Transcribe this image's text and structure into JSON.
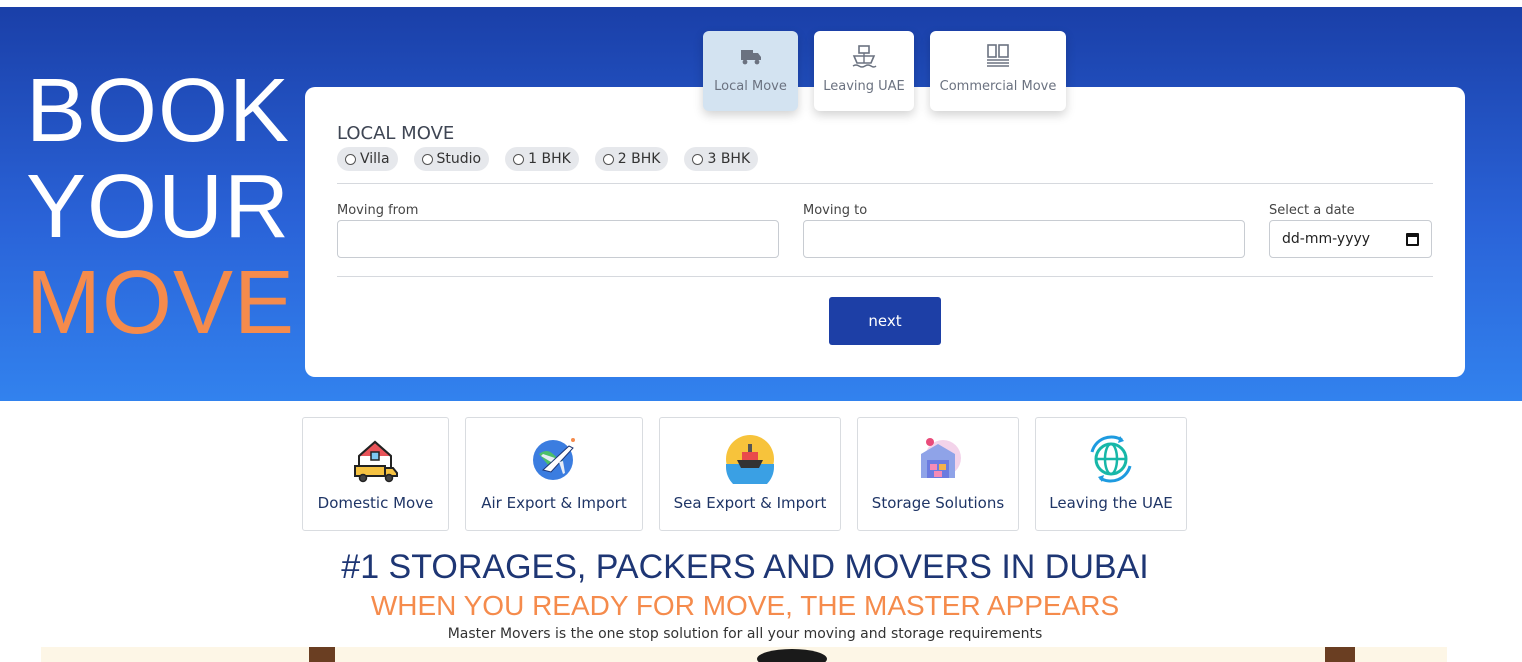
{
  "hero": {
    "title_line1": "BOOK",
    "title_line2": "YOUR",
    "title_line3": "MOVE"
  },
  "tabs": [
    {
      "label": "Local Move",
      "icon": "truck-icon",
      "active": true
    },
    {
      "label": "Leaving UAE",
      "icon": "ship-icon",
      "active": false
    },
    {
      "label": "Commercial Move",
      "icon": "building-icon",
      "active": false
    }
  ],
  "form": {
    "section_title": "LOCAL MOVE",
    "property_types": [
      "Villa",
      "Studio",
      "1 BHK",
      "2 BHK",
      "3 BHK"
    ],
    "moving_from_label": "Moving from",
    "moving_from_value": "",
    "moving_to_label": "Moving to",
    "moving_to_value": "",
    "date_label": "Select a date",
    "date_placeholder": "dd-mm-yyyy",
    "next_label": "next"
  },
  "services": [
    {
      "label": "Domestic Move",
      "icon": "house-truck-icon"
    },
    {
      "label": "Air Export & Import",
      "icon": "airplane-globe-icon"
    },
    {
      "label": "Sea Export & Import",
      "icon": "cargo-ship-icon"
    },
    {
      "label": "Storage Solutions",
      "icon": "warehouse-icon"
    },
    {
      "label": "Leaving the UAE",
      "icon": "globe-arrows-icon"
    }
  ],
  "headline": "#1 STORAGES, PACKERS AND MOVERS IN DUBAI",
  "subheadline": "WHEN YOU READY FOR MOVE, THE MASTER APPEARS",
  "description": "Master Movers is the one stop solution for all your moving and storage requirements",
  "colors": {
    "hero_top": "#1a3fa8",
    "hero_bottom": "#3282ee",
    "accent_orange": "#f58b4c",
    "button_blue": "#1d3fa6",
    "heading_navy": "#1e3674"
  }
}
